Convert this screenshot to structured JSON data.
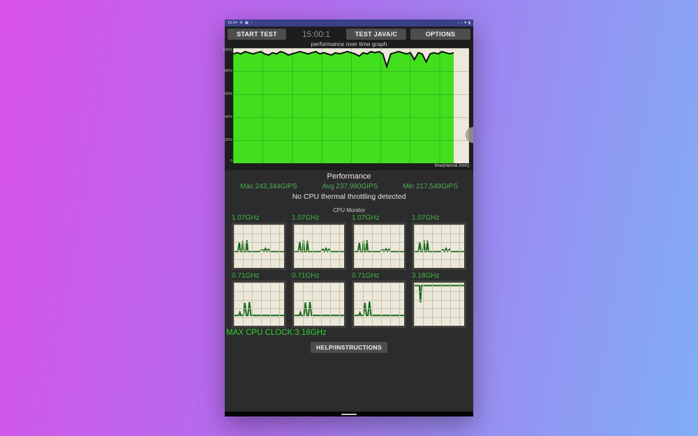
{
  "status_bar": {
    "time": "18:04",
    "left_icons": [
      "gear-icon",
      "app-icon"
    ],
    "right_icons_glyphs": "↕ ○ ▼ ▮"
  },
  "toolbar": {
    "start_label": "START TEST",
    "timer": "15:00:1",
    "test_label": "TEST JAVA/C",
    "options_label": "OPTIONS"
  },
  "performance": {
    "title": "Performance",
    "max": "Max 243,344GIPS",
    "avg": "Avg 237,990GIPS",
    "min": "Min 217,549GIPS",
    "throttle_status": "No CPU thermal throttling detected"
  },
  "cpu_monitor": {
    "title": "CPU Monitor",
    "max_clock": "MAX CPU CLOCK:3.18GHz"
  },
  "help_label": "HELP/INSTRUCTIONS",
  "colors": {
    "fill_green": "#42df1f",
    "stats_green": "#4fae52",
    "label_green": "#3eb83e"
  },
  "chart_data": [
    {
      "id": "performance-over-time",
      "type": "area",
      "title": "performance over time graph",
      "xlabel": "time(interval 2min)",
      "ylabel_ticks": [
        "100%",
        "80%",
        "60%",
        "40%",
        "20%",
        "0"
      ],
      "ylim": [
        0,
        100
      ],
      "grid": true,
      "x_extent_pct": 93.5,
      "trace_pct": [
        95,
        96,
        95,
        97,
        96,
        95,
        96,
        97,
        95,
        94,
        96,
        95,
        97,
        96,
        94,
        95,
        96,
        97,
        96,
        95,
        96,
        97,
        95,
        96,
        95,
        94,
        96,
        95,
        96,
        97,
        96,
        95,
        93,
        96,
        95,
        97,
        96,
        97,
        95,
        84,
        95,
        96,
        97,
        96,
        95,
        96,
        90,
        96,
        95,
        88,
        95,
        96,
        95,
        97,
        96,
        95,
        96
      ]
    },
    {
      "id": "cpu1",
      "type": "line",
      "title": "1.07GHz",
      "points": [
        [
          0,
          62
        ],
        [
          8,
          62
        ],
        [
          11,
          40
        ],
        [
          13,
          62
        ],
        [
          16,
          62
        ],
        [
          18,
          37
        ],
        [
          20,
          62
        ],
        [
          24,
          62
        ],
        [
          26,
          36
        ],
        [
          28,
          62
        ],
        [
          36,
          62
        ],
        [
          50,
          62
        ],
        [
          57,
          58
        ],
        [
          60,
          62
        ],
        [
          63,
          55
        ],
        [
          66,
          62
        ],
        [
          69,
          57
        ],
        [
          72,
          62
        ],
        [
          78,
          62
        ],
        [
          100,
          62
        ]
      ]
    },
    {
      "id": "cpu2",
      "type": "line",
      "title": "1.07GHz",
      "points": [
        [
          0,
          62
        ],
        [
          9,
          62
        ],
        [
          12,
          39
        ],
        [
          14,
          62
        ],
        [
          17,
          62
        ],
        [
          19,
          36
        ],
        [
          21,
          62
        ],
        [
          25,
          62
        ],
        [
          27,
          37
        ],
        [
          29,
          62
        ],
        [
          38,
          62
        ],
        [
          52,
          62
        ],
        [
          58,
          57
        ],
        [
          61,
          62
        ],
        [
          64,
          55
        ],
        [
          67,
          62
        ],
        [
          70,
          57
        ],
        [
          73,
          62
        ],
        [
          80,
          62
        ],
        [
          100,
          62
        ]
      ]
    },
    {
      "id": "cpu3",
      "type": "line",
      "title": "1.07GHz",
      "points": [
        [
          0,
          62
        ],
        [
          8,
          62
        ],
        [
          11,
          41
        ],
        [
          13,
          62
        ],
        [
          17,
          62
        ],
        [
          19,
          37
        ],
        [
          21,
          62
        ],
        [
          24,
          62
        ],
        [
          26,
          36
        ],
        [
          28,
          62
        ],
        [
          37,
          62
        ],
        [
          51,
          62
        ],
        [
          57,
          58
        ],
        [
          60,
          62
        ],
        [
          64,
          56
        ],
        [
          67,
          62
        ],
        [
          70,
          57
        ],
        [
          73,
          62
        ],
        [
          79,
          62
        ],
        [
          100,
          62
        ]
      ]
    },
    {
      "id": "cpu4",
      "type": "line",
      "title": "1.07GHz",
      "points": [
        [
          0,
          62
        ],
        [
          9,
          62
        ],
        [
          12,
          40
        ],
        [
          14,
          62
        ],
        [
          18,
          62
        ],
        [
          20,
          36
        ],
        [
          22,
          62
        ],
        [
          25,
          62
        ],
        [
          27,
          37
        ],
        [
          29,
          62
        ],
        [
          38,
          62
        ],
        [
          52,
          62
        ],
        [
          58,
          58
        ],
        [
          61,
          62
        ],
        [
          64,
          55
        ],
        [
          67,
          62
        ],
        [
          71,
          57
        ],
        [
          74,
          62
        ],
        [
          80,
          62
        ],
        [
          100,
          62
        ]
      ]
    },
    {
      "id": "cpu5",
      "type": "line",
      "title": "0.71GHz",
      "points": [
        [
          0,
          76
        ],
        [
          10,
          76
        ],
        [
          12,
          69
        ],
        [
          14,
          76
        ],
        [
          19,
          76
        ],
        [
          22,
          47
        ],
        [
          25,
          76
        ],
        [
          28,
          76
        ],
        [
          31,
          45
        ],
        [
          34,
          76
        ],
        [
          44,
          76
        ],
        [
          100,
          76
        ]
      ]
    },
    {
      "id": "cpu6",
      "type": "line",
      "title": "0.71GHz",
      "points": [
        [
          0,
          76
        ],
        [
          11,
          76
        ],
        [
          13,
          69
        ],
        [
          15,
          76
        ],
        [
          20,
          76
        ],
        [
          23,
          46
        ],
        [
          26,
          76
        ],
        [
          29,
          76
        ],
        [
          32,
          45
        ],
        [
          35,
          76
        ],
        [
          45,
          76
        ],
        [
          100,
          76
        ]
      ]
    },
    {
      "id": "cpu7",
      "type": "line",
      "title": "0.71GHz",
      "points": [
        [
          0,
          76
        ],
        [
          10,
          76
        ],
        [
          12,
          70
        ],
        [
          14,
          76
        ],
        [
          19,
          76
        ],
        [
          22,
          47
        ],
        [
          25,
          76
        ],
        [
          28,
          76
        ],
        [
          31,
          44
        ],
        [
          34,
          76
        ],
        [
          44,
          76
        ],
        [
          100,
          76
        ]
      ]
    },
    {
      "id": "cpu8",
      "type": "line",
      "title": "3.18GHz",
      "points": [
        [
          0,
          7
        ],
        [
          11,
          7
        ],
        [
          13,
          46
        ],
        [
          15,
          7
        ],
        [
          28,
          7
        ],
        [
          100,
          7
        ]
      ]
    }
  ]
}
